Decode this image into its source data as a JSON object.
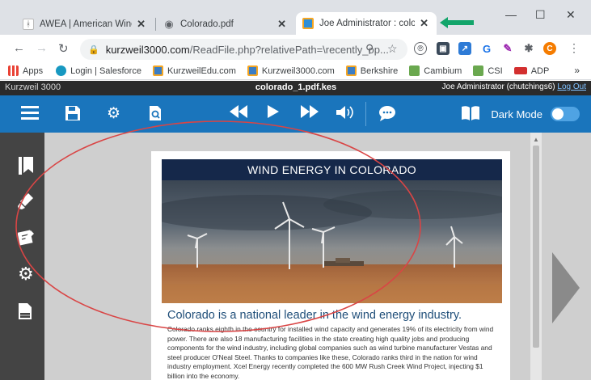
{
  "browser": {
    "tabs": [
      {
        "title": "AWEA | American Wind En",
        "close": "✕",
        "icon": "awea-icon"
      },
      {
        "title": "Colorado.pdf",
        "close": "✕",
        "icon": "globe-icon"
      },
      {
        "title": "Joe Administrator : colorad",
        "close": "✕",
        "icon": "kurzweil-icon"
      }
    ],
    "url_main": "kurzweil3000.com",
    "url_rest": "/ReadFile.php?relativePath=\\recently_op...",
    "profile_initial": "C",
    "bookmarks": [
      {
        "label": "Apps",
        "color": "#e94235"
      },
      {
        "label": "Login | Salesforce",
        "color": "#1798c1"
      },
      {
        "label": "KurzweilEdu.com",
        "color": "#3b7dc4"
      },
      {
        "label": "Kurzweil3000.com",
        "color": "#3b7dc4"
      },
      {
        "label": "Berkshire",
        "color": "#3b7dc4"
      },
      {
        "label": "Cambium",
        "color": "#6aa84f"
      },
      {
        "label": "CSI",
        "color": "#6aa84f"
      },
      {
        "label": "ADP",
        "color": "#d32f2f"
      }
    ],
    "bookmarks_more": "»"
  },
  "app": {
    "brand": "Kurzweil 3000",
    "document": "colorado_1.pdf.kes",
    "user": "Joe Administrator (chutchings6)",
    "logout": "Log Out",
    "dark_mode_label": "Dark Mode",
    "dark_mode_on": false,
    "accent": "#1a75bc"
  },
  "document": {
    "banner": "WIND ENERGY IN COLORADO",
    "headline": "Colorado is a national leader in the wind energy industry.",
    "body": "Colorado ranks eighth in the country for installed wind capacity and generates 19% of its electricity from wind power. There are also 18 manufacturing facilities in the state creating high quality jobs and producing components for the wind industry, including global companies such as wind turbine manufacturer Vestas and steel producer O'Neal Steel. Thanks to companies like these, Colorado ranks third in the nation for wind industry employment. Xcel Energy recently completed the 600 MW Rush Creek Wind Project, injecting $1 billion into the economy."
  }
}
